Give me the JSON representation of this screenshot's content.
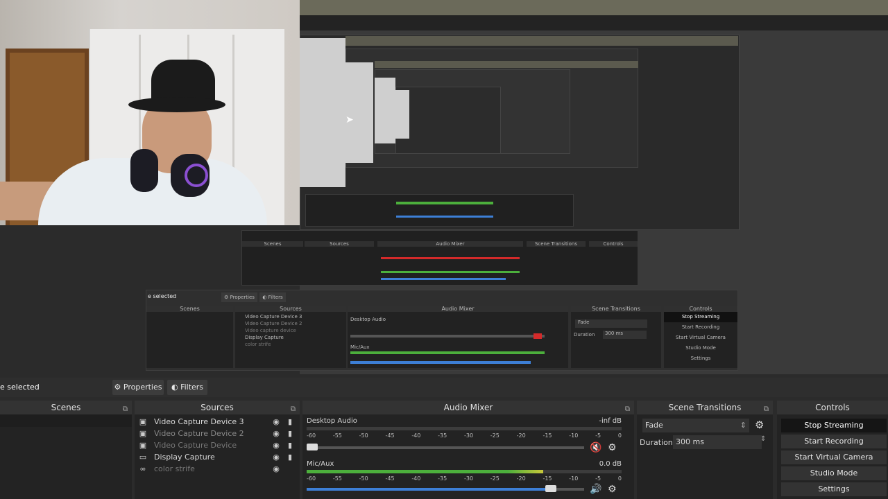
{
  "status": {
    "selection": "e selected",
    "properties_label": "Properties",
    "filters_label": "Filters"
  },
  "docks": {
    "scenes": {
      "title": "Scenes"
    },
    "sources": {
      "title": "Sources",
      "items": [
        {
          "name": "Video Capture Device 3",
          "icon": "camera-icon",
          "dimmed": false
        },
        {
          "name": "Video Capture Device 2",
          "icon": "camera-icon",
          "dimmed": true
        },
        {
          "name": "Video Capture Device",
          "icon": "camera-icon",
          "dimmed": true
        },
        {
          "name": "Display Capture",
          "icon": "monitor-icon",
          "dimmed": false
        },
        {
          "name": "color strife",
          "icon": "link-icon",
          "dimmed": true
        }
      ]
    },
    "audio_mixer": {
      "title": "Audio Mixer",
      "channels": [
        {
          "name": "Desktop Audio",
          "db": "-inf dB",
          "muted": true,
          "level": 0.0,
          "volume": 0.02
        },
        {
          "name": "Mic/Aux",
          "db": "0.0 dB",
          "muted": false,
          "level": 0.75,
          "volume": 0.88
        }
      ],
      "ticks": [
        "-60",
        "-55",
        "-50",
        "-45",
        "-40",
        "-35",
        "-30",
        "-25",
        "-20",
        "-15",
        "-10",
        "-5",
        "0"
      ]
    },
    "transitions": {
      "title": "Scene Transitions",
      "selected": "Fade",
      "duration_label": "Duration",
      "duration_value": "300 ms"
    },
    "controls": {
      "title": "Controls",
      "buttons": [
        "Stop Streaming",
        "Start Recording",
        "Start Virtual Camera",
        "Studio Mode",
        "Settings"
      ]
    }
  },
  "nested": {
    "selection": "e selected",
    "properties_label": "Properties",
    "filters_label": "Filters",
    "scenes": "Scenes",
    "sources": "Sources",
    "mixer": "Audio Mixer",
    "transitions": "Scene Transitions",
    "controls": "Controls",
    "sources_items": [
      "Video Capture Device 3",
      "Video Capture Device 2",
      "Video capture device",
      "Display Capture",
      "color strife"
    ],
    "desktop_audio": "Desktop Audio",
    "mic": "Mic/Aux",
    "fade": "Fade",
    "duration": "Duration",
    "duration_val": "300 ms",
    "controls_buttons": [
      "Stop Streaming",
      "Start Recording",
      "Start Virtual Camera",
      "Studio Mode",
      "Settings"
    ]
  },
  "colors": {
    "accent_green": "#4caf3c",
    "mute_red": "#d42a2a",
    "volume_blue": "#3d7fd6"
  }
}
